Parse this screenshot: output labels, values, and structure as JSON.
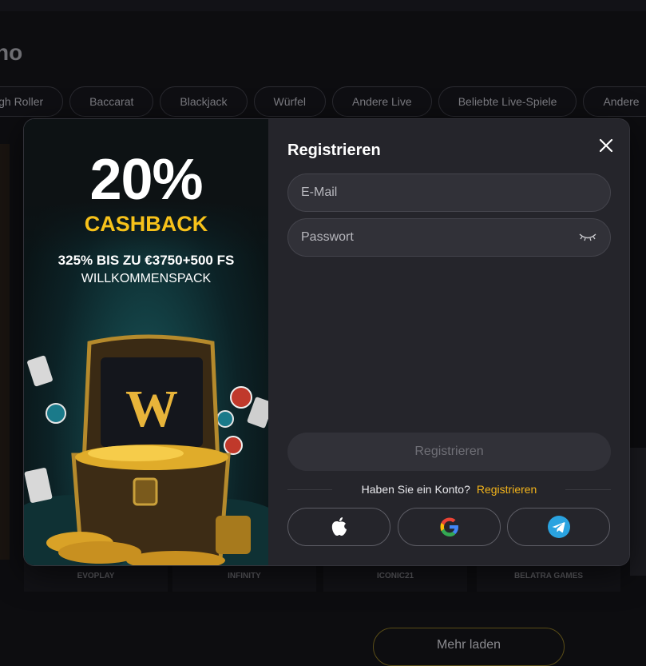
{
  "background": {
    "section_title": "no",
    "categories": [
      "igh Roller",
      "Baccarat",
      "Blackjack",
      "Würfel",
      "Andere Live",
      "Beliebte Live-Spiele",
      "Andere"
    ],
    "providers": [
      "EVOPLAY",
      "INFINITY",
      "ICONIC21",
      "BELATRA GAMES"
    ],
    "load_more_label": "Mehr laden"
  },
  "promo": {
    "percent": "20%",
    "cashback": "CASHBACK",
    "bonus_line1": "325% BIS ZU €3750+500 FS",
    "bonus_line2": "WILLKOMMENSPACK",
    "chest_letter": "W"
  },
  "form": {
    "title": "Registrieren",
    "email_placeholder": "E-Mail",
    "password_placeholder": "Passwort",
    "submit_label": "Registrieren",
    "have_account_text": "Haben Sie ein Konto?",
    "register_link": "Registrieren"
  },
  "colors": {
    "accent": "#f2b31b",
    "cashback": "#f7c21a",
    "modal_bg": "#25252b",
    "telegram": "#2aa3e0"
  },
  "icons": {
    "close": "close-icon",
    "eye": "eye-closed-icon",
    "apple": "apple-icon",
    "google": "google-icon",
    "telegram": "telegram-icon"
  }
}
